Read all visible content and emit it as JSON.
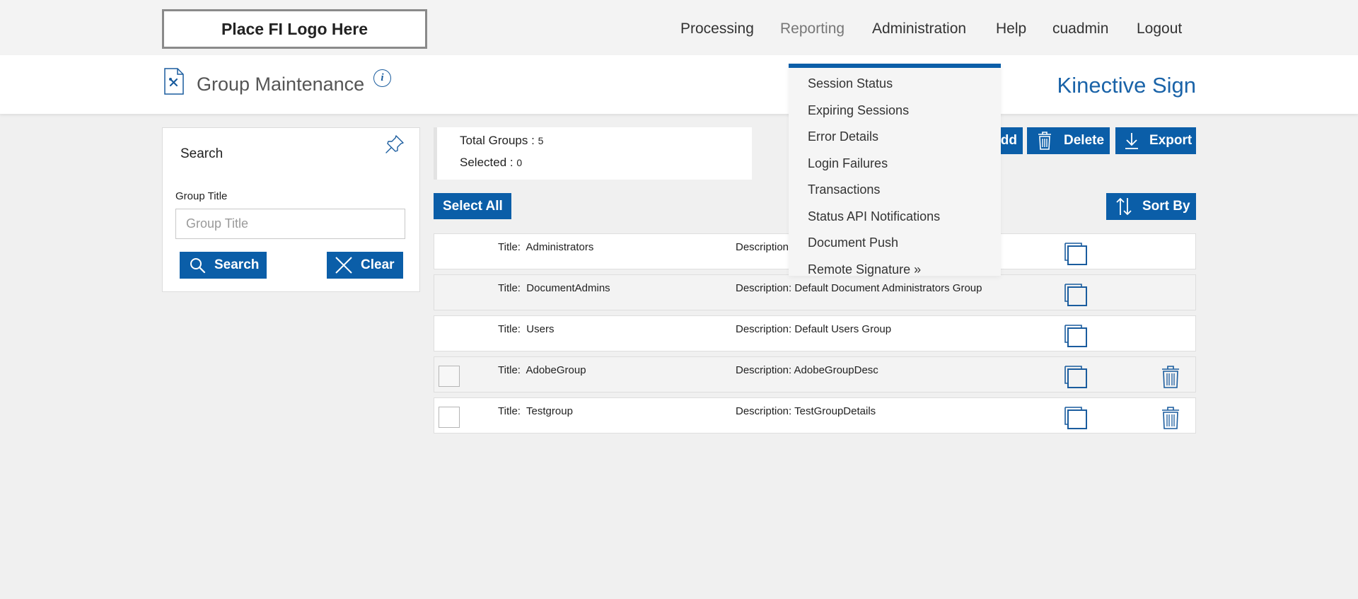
{
  "topbar": {
    "logo_text": "Place FI Logo Here",
    "nav": [
      "Processing",
      "Reporting",
      "Administration",
      "Help",
      "cuadmin",
      "Logout"
    ]
  },
  "header": {
    "title": "Group Maintenance",
    "info": "i",
    "brand": "Kinective Sign"
  },
  "search": {
    "title": "Search",
    "field_label": "Group Title",
    "field_placeholder": "Group Title",
    "search_button": "Search",
    "clear_button": "Clear"
  },
  "totals": {
    "total_label": "Total Groups : ",
    "total_value": "5",
    "selected_label": "Selected : ",
    "selected_value": "0"
  },
  "actions": {
    "add_button": "dd",
    "delete_button": "Delete",
    "export_button": "Export",
    "select_all_button": "Select All",
    "sort_button": "Sort By"
  },
  "groups": [
    {
      "title_label": "Title:",
      "title": "Administrators",
      "desc_label": "Description",
      "desc": ""
    },
    {
      "title_label": "Title:",
      "title": "DocumentAdmins",
      "desc_label": "Description:",
      "desc": "Default Document Administrators Group"
    },
    {
      "title_label": "Title:",
      "title": "Users",
      "desc_label": "Description:",
      "desc": "Default Users Group"
    },
    {
      "title_label": "Title:",
      "title": "AdobeGroup",
      "desc_label": "Description:",
      "desc": "AdobeGroupDesc"
    },
    {
      "title_label": "Title:",
      "title": "Testgroup",
      "desc_label": "Description:",
      "desc": "TestGroupDetails"
    }
  ],
  "reporting_menu": [
    "Session Status",
    "Expiring Sessions",
    "Error Details",
    "Login Failures",
    "Transactions",
    "Status API Notifications",
    "Document Push",
    "Remote Signature »"
  ],
  "colors": {
    "accent": "#0b5ea8",
    "brand_text": "#1a63a8",
    "background": "#f0f0f0"
  }
}
